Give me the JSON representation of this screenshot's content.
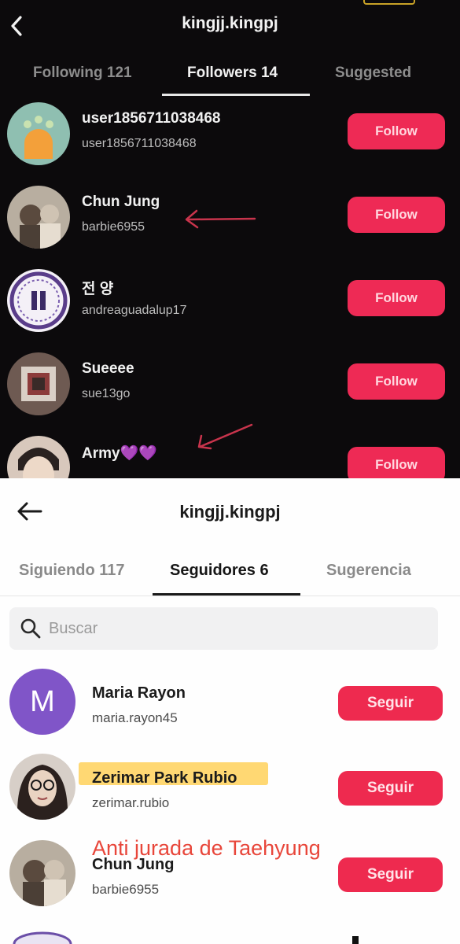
{
  "dark_panel": {
    "title": "kingjj.kingpj",
    "back_icon": "chevron-left-icon",
    "tabs": [
      {
        "label": "Following 121"
      },
      {
        "label": "Followers 14"
      },
      {
        "label": "Suggested"
      }
    ],
    "users": [
      {
        "name": "user1856711038468",
        "handle": "user1856711038468",
        "button": "Follow"
      },
      {
        "name": "Chun Jung",
        "handle": "barbie6955",
        "button": "Follow"
      },
      {
        "name": "전 양",
        "handle": "andreaguadalup17",
        "button": "Follow"
      },
      {
        "name": "Sueeee",
        "handle": "sue13go",
        "button": "Follow"
      },
      {
        "name": "Army💜💜",
        "handle": "",
        "button": "Follow"
      }
    ]
  },
  "light_panel": {
    "title": "kingjj.kingpj",
    "back_icon": "arrow-left-icon",
    "tabs": [
      {
        "label": "Siguiendo 117"
      },
      {
        "label": "Seguidores 6"
      },
      {
        "label": "Sugerencia"
      }
    ],
    "search": {
      "placeholder": "Buscar",
      "icon": "search-icon"
    },
    "users": [
      {
        "name": "Maria Rayon",
        "handle": "maria.rayon45",
        "button": "Seguir",
        "avatar_letter": "M"
      },
      {
        "name": "Zerimar Park Rubio",
        "handle": "zerimar.rubio",
        "button": "Seguir"
      },
      {
        "name": "Chun Jung",
        "handle": "barbie6955",
        "button": "Seguir"
      }
    ],
    "annotation": "Anti jurada de Taehyung"
  },
  "colors": {
    "follow_button": "#ee2a55",
    "annotation": "#e8463a",
    "highlight": "#ffd873",
    "avatar_purple": "#8055c8"
  }
}
